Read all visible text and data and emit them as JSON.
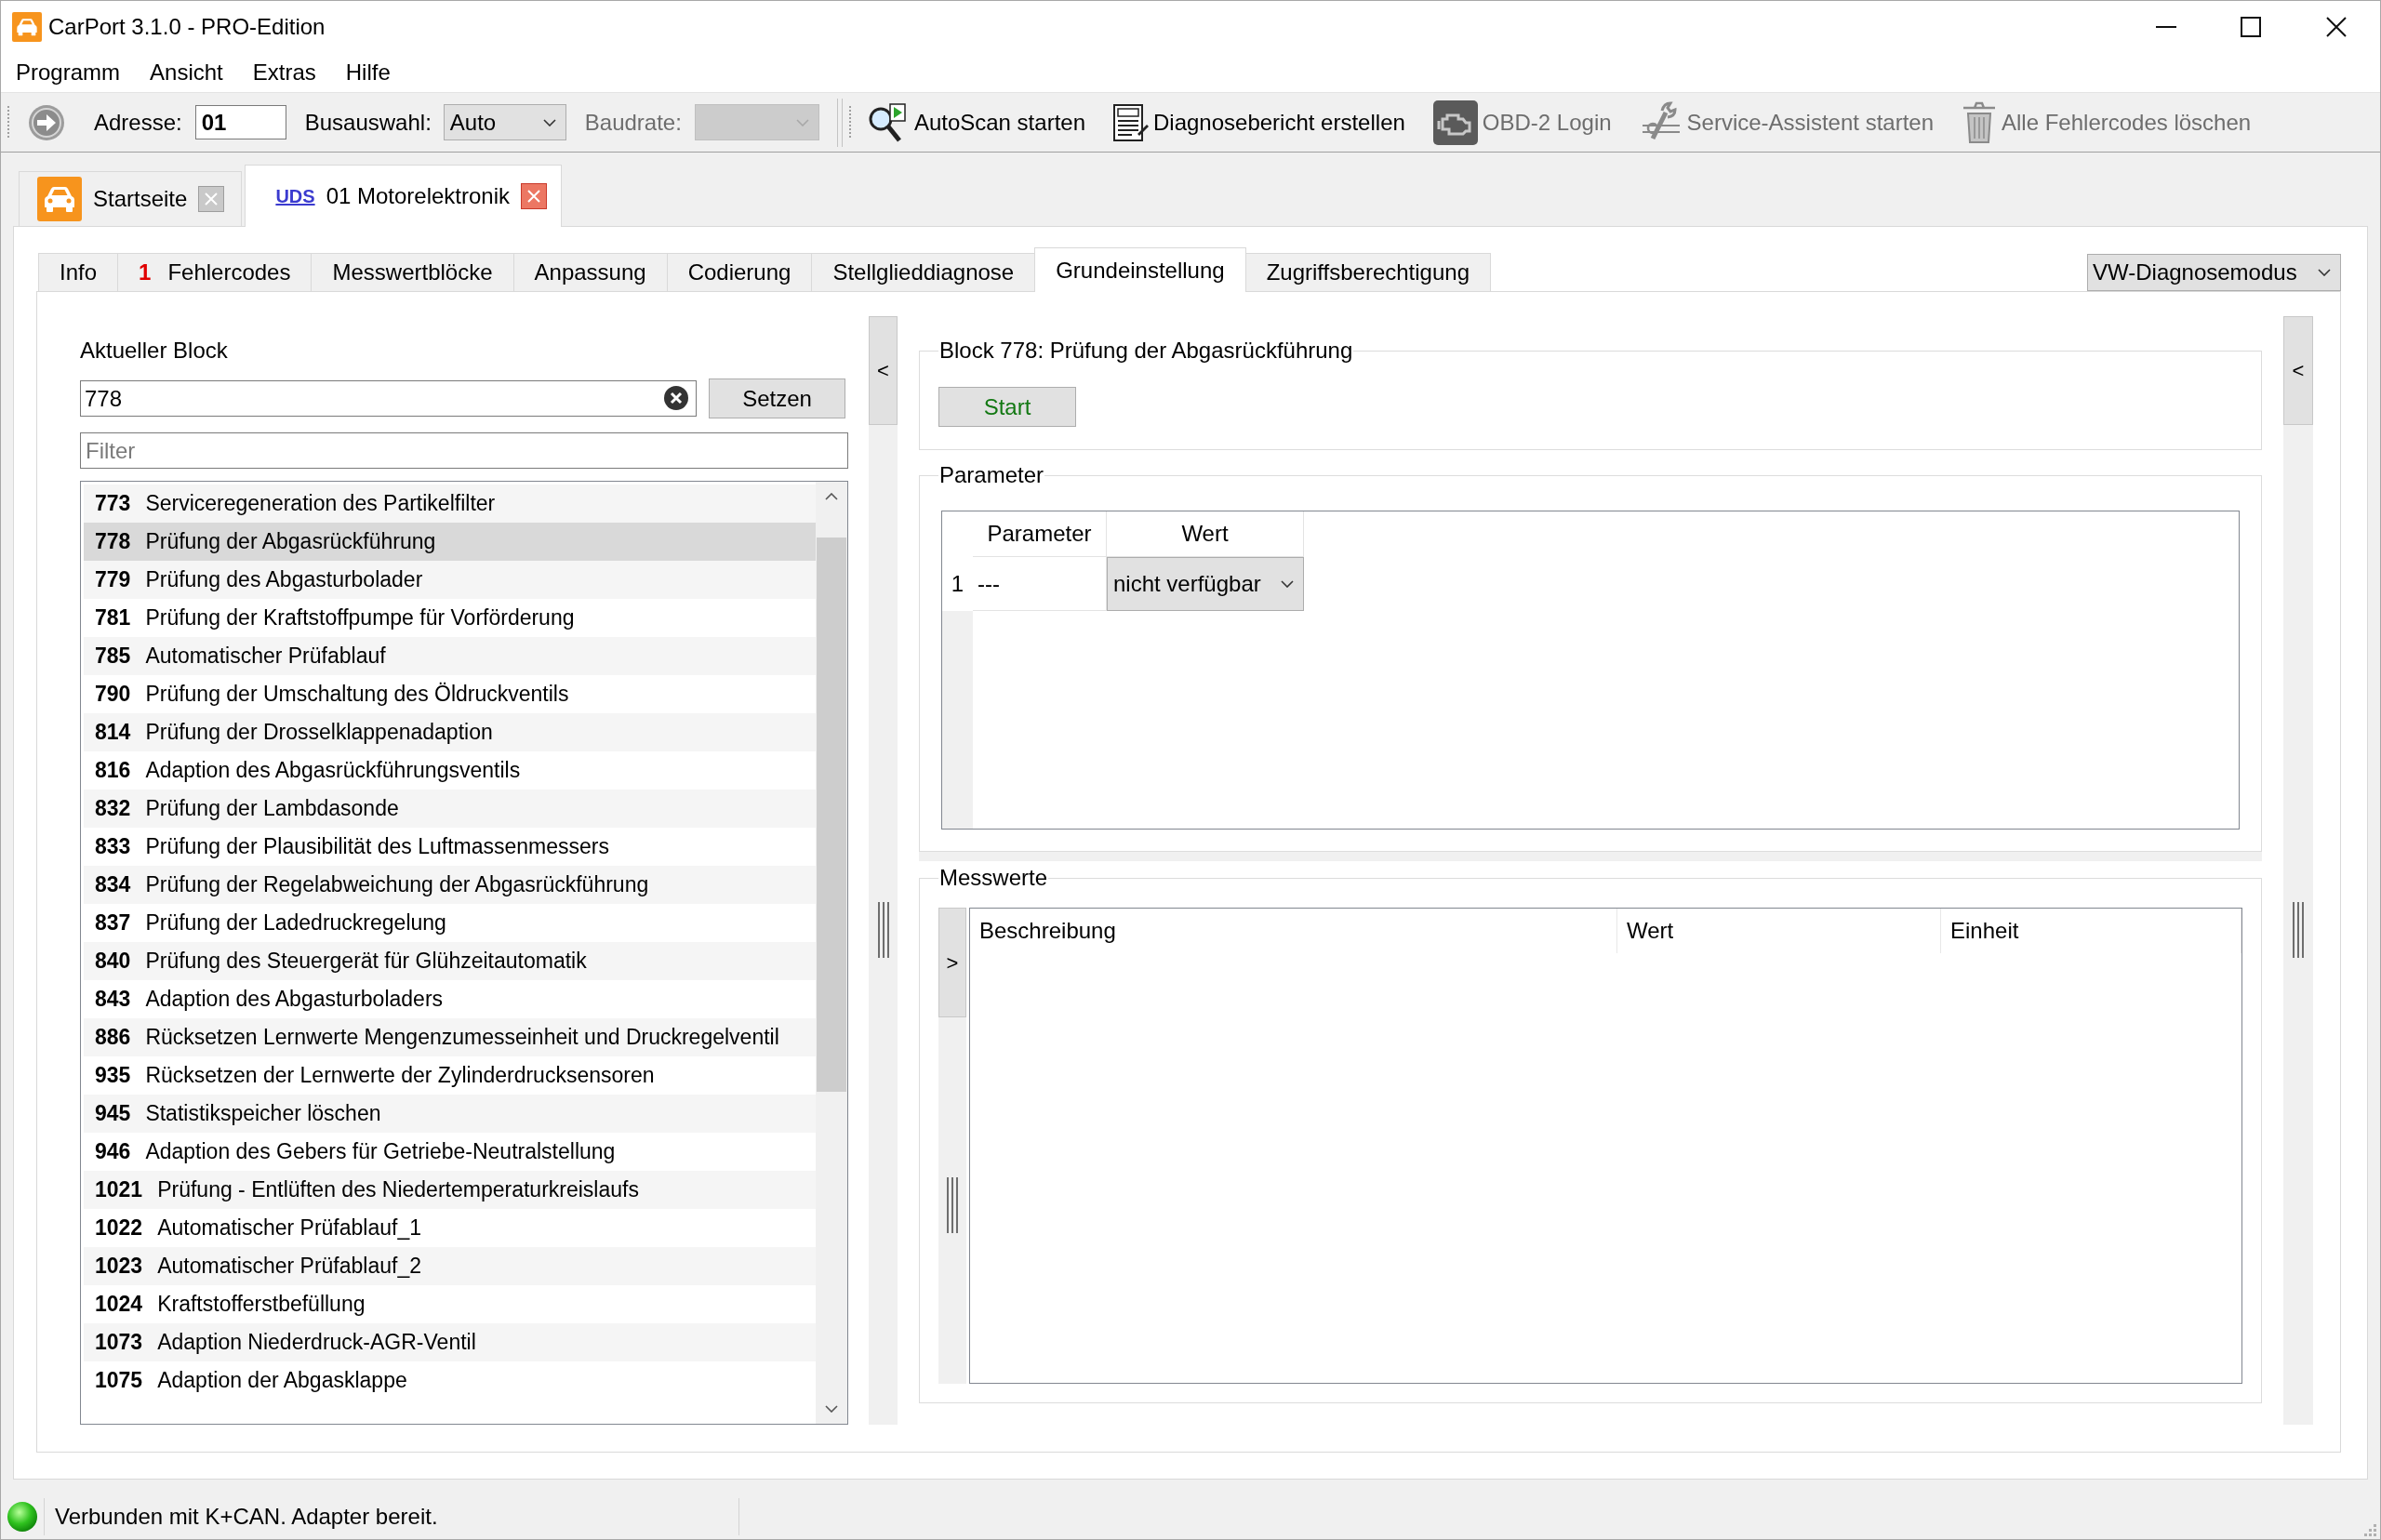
{
  "window": {
    "title": "CarPort 3.1.0 - PRO-Edition"
  },
  "menu": [
    {
      "label": "Programm"
    },
    {
      "label": "Ansicht"
    },
    {
      "label": "Extras"
    },
    {
      "label": "Hilfe"
    }
  ],
  "toolbar": {
    "address": {
      "label": "Adresse:",
      "value": "01"
    },
    "bus": {
      "label": "Busauswahl:",
      "value": "Auto"
    },
    "baudrate": {
      "label": "Baudrate:",
      "disabled": true
    },
    "actions": [
      {
        "kind": "autoscan",
        "label": "AutoScan starten",
        "disabled": false
      },
      {
        "kind": "report",
        "label": "Diagnosebericht erstellen",
        "disabled": false
      },
      {
        "kind": "obd",
        "label": "OBD-2 Login",
        "disabled": true
      },
      {
        "kind": "service",
        "label": "Service-Assistent starten",
        "disabled": true
      },
      {
        "kind": "delete",
        "label": "Alle Fehlercodes löschen",
        "disabled": true
      }
    ]
  },
  "document_tabs": [
    {
      "kind": "home",
      "label": "Startseite",
      "selected": false
    },
    {
      "kind": "module",
      "protocol": "UDS",
      "label": "01 Motorelektronik",
      "selected": true
    }
  ],
  "module_tabs": [
    {
      "label": "Info",
      "selected": false
    },
    {
      "label": "Fehlercodes",
      "count": "1",
      "selected": false
    },
    {
      "label": "Messwertblöcke",
      "selected": false
    },
    {
      "label": "Anpassung",
      "selected": false
    },
    {
      "label": "Codierung",
      "selected": false
    },
    {
      "label": "Stellglieddiagnose",
      "selected": false
    },
    {
      "label": "Grundeinstellung",
      "selected": true
    },
    {
      "label": "Zugriffsberechtigung",
      "selected": false
    }
  ],
  "diagnosis_mode": "VW-Diagnosemodus",
  "block_panel": {
    "label": "Aktueller Block",
    "value": "778",
    "set_button": "Setzen",
    "filter_placeholder": "Filter",
    "blocks": [
      {
        "number": "773",
        "name": "Serviceregeneration des Partikelfilter",
        "selected": false
      },
      {
        "number": "778",
        "name": "Prüfung der Abgasrückführung",
        "selected": true
      },
      {
        "number": "779",
        "name": "Prüfung des Abgasturbolader",
        "selected": false
      },
      {
        "number": "781",
        "name": "Prüfung der Kraftstoffpumpe für Vorförderung",
        "selected": false
      },
      {
        "number": "785",
        "name": "Automatischer Prüfablauf",
        "selected": false
      },
      {
        "number": "790",
        "name": "Prüfung der Umschaltung des Öldruckventils",
        "selected": false
      },
      {
        "number": "814",
        "name": "Prüfung der Drosselklappenadaption",
        "selected": false
      },
      {
        "number": "816",
        "name": "Adaption des Abgasrückführungsventils",
        "selected": false
      },
      {
        "number": "832",
        "name": "Prüfung der Lambdasonde",
        "selected": false
      },
      {
        "number": "833",
        "name": "Prüfung der Plausibilität des Luftmassenmessers",
        "selected": false
      },
      {
        "number": "834",
        "name": "Prüfung der Regelabweichung der Abgasrückführung",
        "selected": false
      },
      {
        "number": "837",
        "name": "Prüfung der Ladedruckregelung",
        "selected": false
      },
      {
        "number": "840",
        "name": "Prüfung des Steuergerät für Glühzeitautomatik",
        "selected": false
      },
      {
        "number": "843",
        "name": "Adaption des Abgasturboladers",
        "selected": false
      },
      {
        "number": "886",
        "name": "Rücksetzen Lernwerte Mengenzumesseinheit und Druckregelventil",
        "selected": false
      },
      {
        "number": "935",
        "name": "Rücksetzen der Lernwerte der Zylinderdrucksensoren",
        "selected": false
      },
      {
        "number": "945",
        "name": "Statistikspeicher löschen",
        "selected": false
      },
      {
        "number": "946",
        "name": "Adaption des Gebers für Getriebe-Neutralstellung",
        "selected": false
      },
      {
        "number": "1021",
        "name": "Prüfung - Entlüften des Niedertemperaturkreislaufs",
        "selected": false
      },
      {
        "number": "1022",
        "name": "Automatischer Prüfablauf_1",
        "selected": false
      },
      {
        "number": "1023",
        "name": "Automatischer Prüfablauf_2",
        "selected": false
      },
      {
        "number": "1024",
        "name": "Kraftstofferstbefüllung",
        "selected": false
      },
      {
        "number": "1073",
        "name": "Adaption Niederdruck-AGR-Ventil",
        "selected": false
      },
      {
        "number": "1075",
        "name": "Adaption der Abgasklappe",
        "selected": false
      }
    ]
  },
  "left_splitter": {
    "toggle": "<"
  },
  "block_group": {
    "title": "Block 778: Prüfung der Abgasrückführung",
    "start_button": "Start"
  },
  "parameters": {
    "title": "Parameter",
    "columns": [
      "Parameter",
      "Wert"
    ],
    "rows": [
      {
        "number": "1",
        "parameter": "---",
        "value": "nicht verfügbar"
      }
    ]
  },
  "measurements": {
    "title": "Messwerte",
    "toggle": ">",
    "columns": [
      "Beschreibung",
      "Wert",
      "Einheit"
    ]
  },
  "right_splitter": {
    "toggle": "<"
  },
  "status_bar": {
    "connected": true,
    "text": "Verbunden mit K+CAN. Adapter bereit."
  }
}
